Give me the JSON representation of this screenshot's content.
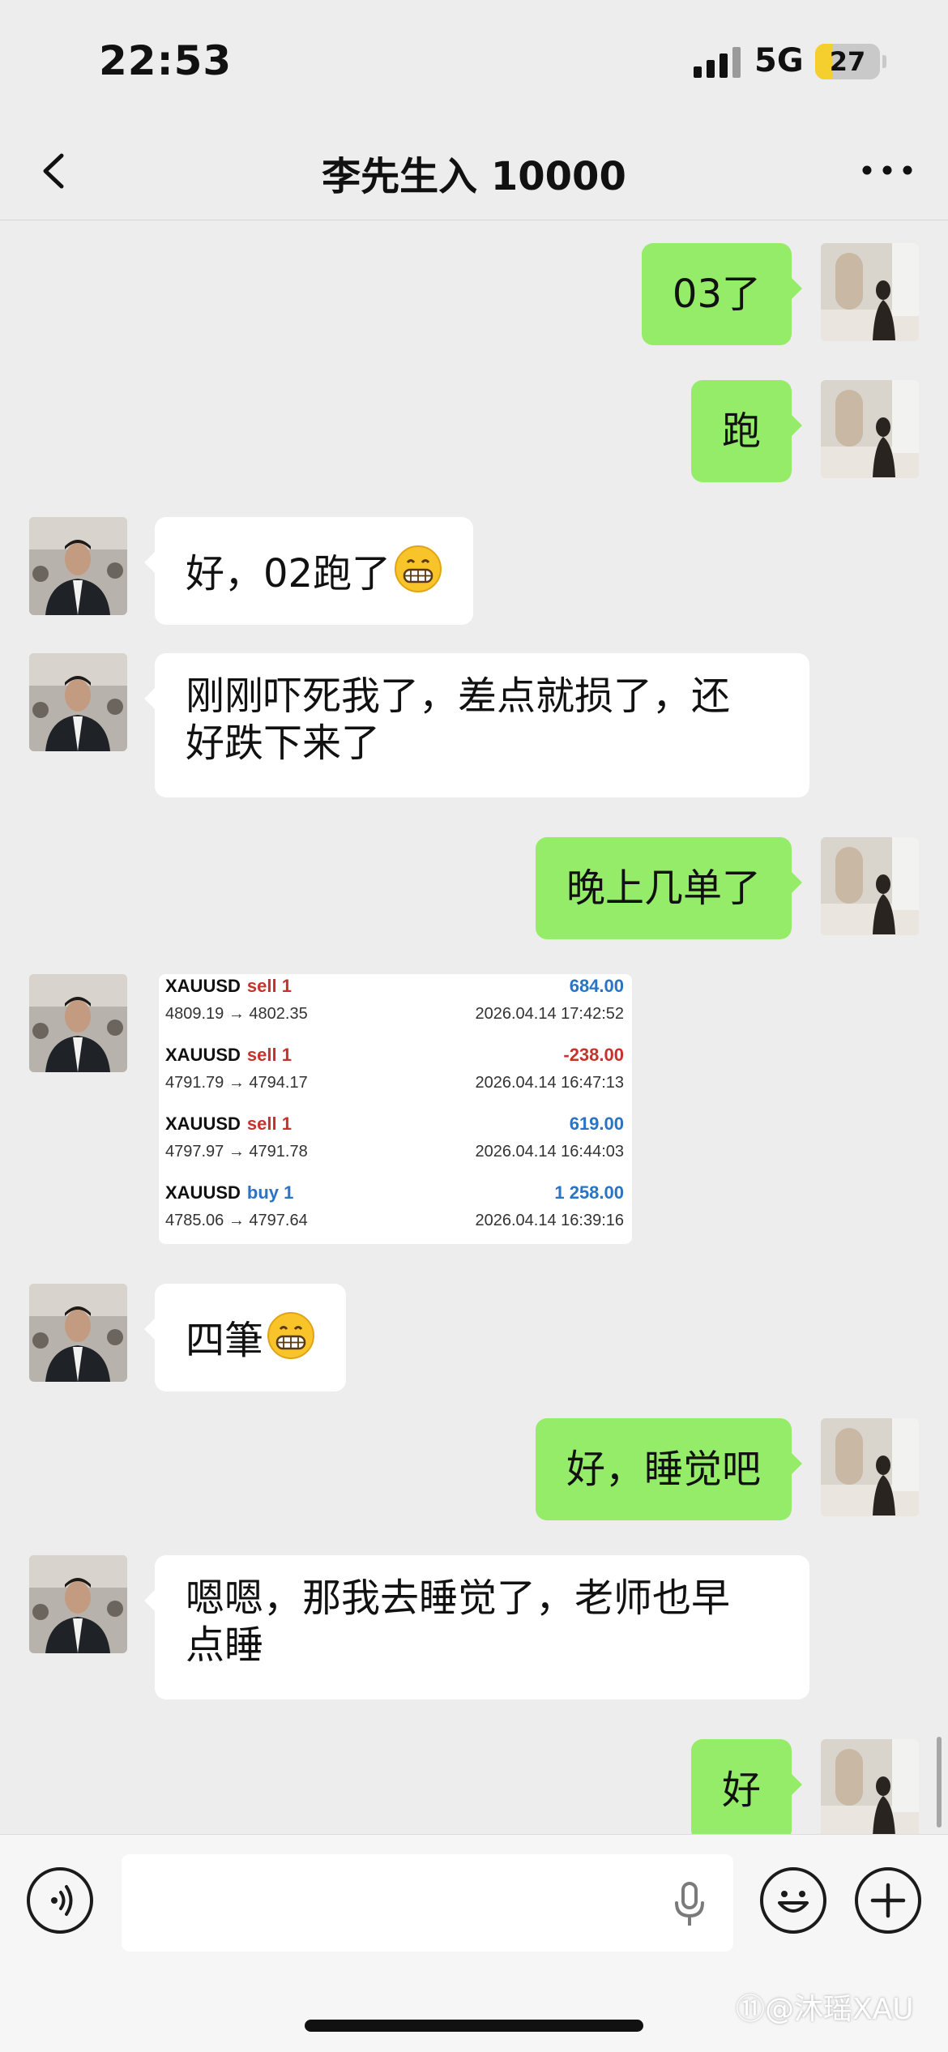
{
  "status": {
    "time": "22:53",
    "network": "5G",
    "battery": "27",
    "battery_level": 0.27
  },
  "nav": {
    "title": "李先生入 10000",
    "back_icon": "chevron-left-icon",
    "more_icon": "more-dots-icon"
  },
  "messages": [
    {
      "from": "me",
      "text": "03了"
    },
    {
      "from": "me",
      "text": "跑"
    },
    {
      "from": "contact",
      "text": "好，02跑了",
      "emoji": "grinning-face-emoji"
    },
    {
      "from": "contact",
      "lines": [
        "刚刚吓死我了，差点就损了，还",
        "好跌下来了"
      ]
    },
    {
      "from": "me",
      "text": "晚上几单了"
    },
    {
      "from": "contact",
      "type": "trade-card"
    },
    {
      "from": "contact",
      "text": "四筆",
      "emoji": "grinning-face-emoji"
    },
    {
      "from": "me",
      "text": "好，睡觉吧"
    },
    {
      "from": "contact",
      "lines": [
        "嗯嗯，那我去睡觉了，老师也早",
        "点睡"
      ]
    },
    {
      "from": "me",
      "text": "好"
    }
  ],
  "trades": [
    {
      "symbol": "XAUUSD",
      "side": "sell 1",
      "prices": "4809.19 → 4802.35",
      "profit": "684.00",
      "date": "2026.04.14 17:42:52"
    },
    {
      "symbol": "XAUUSD",
      "side": "sell 1",
      "prices": "4791.79 → 4794.17",
      "profit": "-238.00",
      "date": "2026.04.14 16:47:13"
    },
    {
      "symbol": "XAUUSD",
      "side": "sell 1",
      "prices": "4797.97 → 4791.78",
      "profit": "619.00",
      "date": "2026.04.14 16:44:03"
    },
    {
      "symbol": "XAUUSD",
      "side": "buy 1",
      "prices": "4785.06 → 4797.64",
      "profit": "1 258.00",
      "date": "2026.04.14 16:39:16"
    }
  ],
  "colors": {
    "sell": "#c8322d",
    "buy": "#2a73c5",
    "profit_positive": "#2a73c5",
    "profit_negative": "#c8322d",
    "my_bubble": "#95ec69"
  },
  "input_bar": {
    "voice_icon": "voice-icon",
    "mic_icon": "microphone-icon",
    "emoji_icon": "smiley-icon",
    "plus_icon": "plus-icon"
  },
  "watermark": "⑪@沐瑶XAU"
}
